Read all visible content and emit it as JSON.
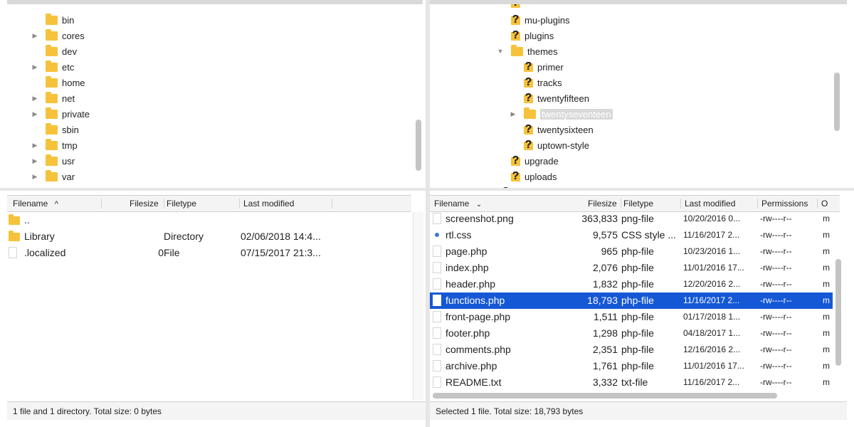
{
  "local_tree": {
    "items": [
      {
        "label": "bin",
        "expandable": false
      },
      {
        "label": "cores",
        "expandable": true
      },
      {
        "label": "dev",
        "expandable": false
      },
      {
        "label": "etc",
        "expandable": true
      },
      {
        "label": "home",
        "expandable": false
      },
      {
        "label": "net",
        "expandable": true
      },
      {
        "label": "private",
        "expandable": true
      },
      {
        "label": "sbin",
        "expandable": false
      },
      {
        "label": "tmp",
        "expandable": true
      },
      {
        "label": "usr",
        "expandable": true
      },
      {
        "label": "var",
        "expandable": true
      }
    ]
  },
  "remote_tree": {
    "items": [
      {
        "label": "mu-plugins",
        "icon": "question-folder-icon"
      },
      {
        "label": "plugins",
        "icon": "question-folder-icon"
      },
      {
        "label": "themes",
        "icon": "folder-icon",
        "expanded": true
      },
      {
        "label": "primer",
        "icon": "question-folder-icon"
      },
      {
        "label": "tracks",
        "icon": "question-folder-icon"
      },
      {
        "label": "twentyfifteen",
        "icon": "question-folder-icon"
      },
      {
        "label": "twentyseventeen",
        "icon": "folder-icon",
        "selected": true
      },
      {
        "label": "twentysixteen",
        "icon": "question-folder-icon"
      },
      {
        "label": "uptown-style",
        "icon": "question-folder-icon"
      },
      {
        "label": "upgrade",
        "icon": "question-folder-icon"
      },
      {
        "label": "uploads",
        "icon": "question-folder-icon"
      }
    ]
  },
  "local_list": {
    "headers": {
      "filename": "Filename",
      "filesize": "Filesize",
      "filetype": "Filetype",
      "modified": "Last modified"
    },
    "sort_icon": "chevron-up-icon",
    "rows": [
      {
        "name": "..",
        "size": "",
        "type": "",
        "modified": "",
        "icon": "folder"
      },
      {
        "name": "Library",
        "size": "",
        "type": "Directory",
        "modified": "02/06/2018 14:4...",
        "icon": "folder"
      },
      {
        "name": ".localized",
        "size": "0",
        "type": "File",
        "modified": "07/15/2017 21:3...",
        "icon": "file"
      }
    ],
    "status": "1 file and 1 directory. Total size: 0 bytes"
  },
  "remote_list": {
    "headers": {
      "filename": "Filename",
      "filesize": "Filesize",
      "filetype": "Filetype",
      "modified": "Last modified",
      "permissions": "Permissions",
      "owner": "O"
    },
    "sort_icon": "chevron-down-icon",
    "rows": [
      {
        "name": "screenshot.png",
        "size": "363,833",
        "type": "png-file",
        "modified": "10/20/2016 0...",
        "perm": "-rw----r--",
        "owner": "m",
        "icon": "file"
      },
      {
        "name": "rtl.css",
        "size": "9,575",
        "type": "CSS style ...",
        "modified": "11/16/2017 2...",
        "perm": "-rw----r--",
        "owner": "m",
        "icon": "css"
      },
      {
        "name": "page.php",
        "size": "965",
        "type": "php-file",
        "modified": "10/23/2016 1...",
        "perm": "-rw----r--",
        "owner": "m",
        "icon": "file"
      },
      {
        "name": "index.php",
        "size": "2,076",
        "type": "php-file",
        "modified": "11/01/2016 17...",
        "perm": "-rw----r--",
        "owner": "m",
        "icon": "file"
      },
      {
        "name": "header.php",
        "size": "1,832",
        "type": "php-file",
        "modified": "12/20/2016 2...",
        "perm": "-rw----r--",
        "owner": "m",
        "icon": "file"
      },
      {
        "name": "functions.php",
        "size": "18,793",
        "type": "php-file",
        "modified": "11/16/2017 2...",
        "perm": "-rw----r--",
        "owner": "m",
        "icon": "file",
        "selected": true
      },
      {
        "name": "front-page.php",
        "size": "1,511",
        "type": "php-file",
        "modified": "01/17/2018 1...",
        "perm": "-rw----r--",
        "owner": "m",
        "icon": "file"
      },
      {
        "name": "footer.php",
        "size": "1,298",
        "type": "php-file",
        "modified": "04/18/2017 1...",
        "perm": "-rw----r--",
        "owner": "m",
        "icon": "file"
      },
      {
        "name": "comments.php",
        "size": "2,351",
        "type": "php-file",
        "modified": "12/16/2016 2...",
        "perm": "-rw----r--",
        "owner": "m",
        "icon": "file"
      },
      {
        "name": "archive.php",
        "size": "1,761",
        "type": "php-file",
        "modified": "11/01/2016 17...",
        "perm": "-rw----r--",
        "owner": "m",
        "icon": "file"
      },
      {
        "name": "README.txt",
        "size": "3,332",
        "type": "txt-file",
        "modified": "11/16/2017 2...",
        "perm": "-rw----r--",
        "owner": "m",
        "icon": "file"
      }
    ],
    "status": "Selected 1 file. Total size: 18,793 bytes"
  },
  "colors": {
    "selection": "#1558d6",
    "folder": "#f7c23b"
  }
}
